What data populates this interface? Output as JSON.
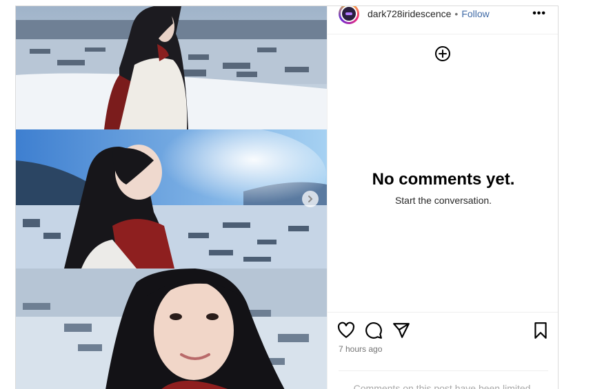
{
  "post": {
    "username": "dark728iridescence",
    "separator": "•",
    "follow_label": "Follow",
    "more_icon": "more-options-icon",
    "more_label": "•••"
  },
  "comments": {
    "empty_title": "No comments yet.",
    "empty_subtitle": "Start the conversation."
  },
  "actions": {
    "timestamp": "7 hours ago",
    "comments_limited": "Comments on this post have been limited."
  },
  "colors": {
    "follow": "#3f6aa6",
    "muted": "#737373"
  }
}
